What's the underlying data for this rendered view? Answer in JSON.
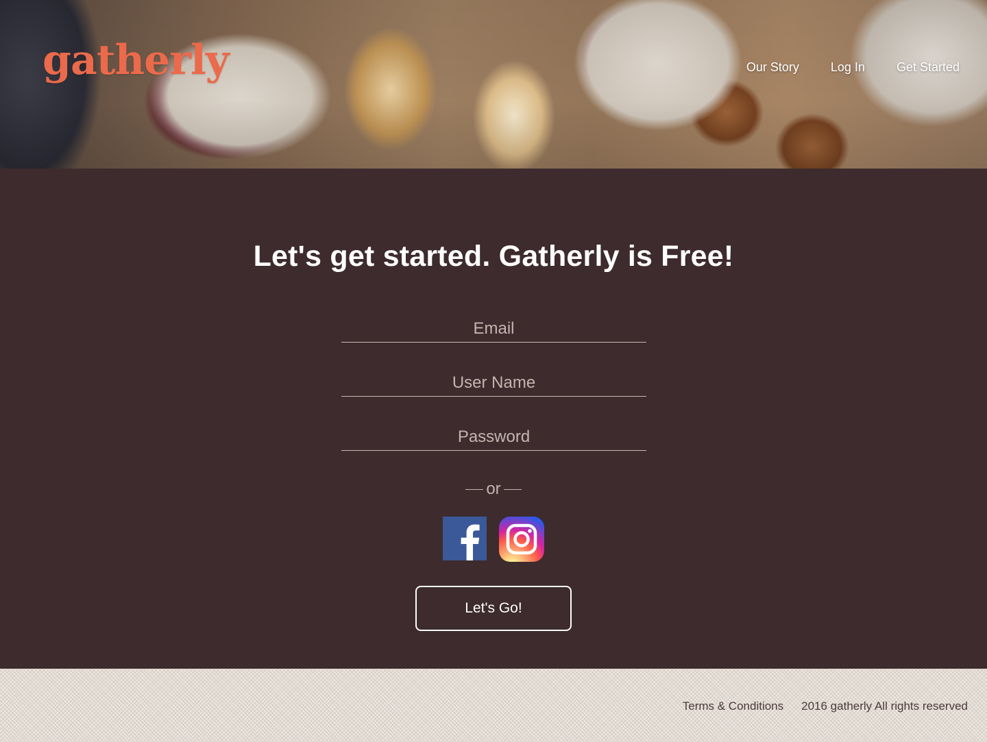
{
  "header": {
    "logo_text": "gatherly",
    "nav": {
      "our_story": "Our Story",
      "log_in": "Log In",
      "get_started": "Get Started"
    }
  },
  "signup": {
    "headline": "Let's get started. Gatherly is Free!",
    "email_placeholder": "Email",
    "username_placeholder": "User Name",
    "password_placeholder": "Password",
    "or_text": "or",
    "social": {
      "facebook_icon": "facebook-icon",
      "instagram_icon": "instagram-icon"
    },
    "submit_label": "Let's Go!"
  },
  "footer": {
    "terms": "Terms & Conditions",
    "copyright": "2016 gatherly All rights reserved"
  },
  "colors": {
    "brand_logo": "#ea6a4b",
    "panel_background": "#3d2b2e",
    "facebook_blue": "#3b5998",
    "footer_background": "#e2d9cf"
  }
}
